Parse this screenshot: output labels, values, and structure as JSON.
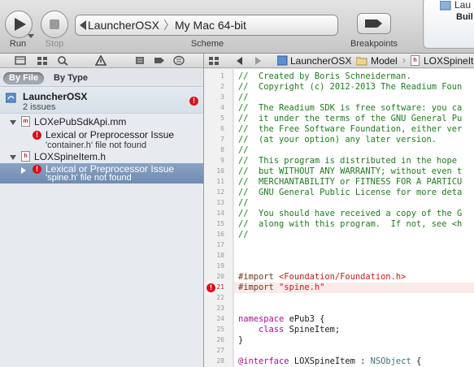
{
  "toolbar": {
    "run_label": "Run",
    "stop_label": "Stop",
    "scheme_target": "LauncherOSX",
    "scheme_destination": "My Mac 64-bit",
    "scheme_label": "Scheme",
    "breakpoints_label": "Breakpoints",
    "activity_title": "Lau",
    "activity_sub": "Buil"
  },
  "navigator": {
    "filter_by_file": "By File",
    "filter_by_type": "By Type",
    "project": {
      "name": "LauncherOSX",
      "count": "2 issues"
    },
    "files": [
      {
        "icon": "m",
        "name": "LOXePubSdkApi.mm",
        "issue_title": "Lexical or Preprocessor Issue",
        "issue_detail": "'container.h' file not found"
      },
      {
        "icon": "h",
        "name": "LOXSpineItem.h",
        "issue_title": "Lexical or Preprocessor Issue",
        "issue_detail": "'spine.h' file not found"
      }
    ]
  },
  "jumpbar": {
    "crumb1": "LauncherOSX",
    "crumb2": "Model",
    "crumb3": "LOXSpineIte"
  },
  "editor": {
    "lines": [
      {
        "n": "1",
        "t": "//  Created by Boris Schneiderman.",
        "c": "cmt"
      },
      {
        "n": "2",
        "t": "//  Copyright (c) 2012-2013 The Readium Foun",
        "c": "cmt"
      },
      {
        "n": "3",
        "t": "//",
        "c": "cmt"
      },
      {
        "n": "4",
        "t": "//  The Readium SDK is free software: you ca",
        "c": "cmt"
      },
      {
        "n": "5",
        "t": "//  it under the terms of the GNU General Pu",
        "c": "cmt"
      },
      {
        "n": "6",
        "t": "//  the Free Software Foundation, either ver",
        "c": "cmt"
      },
      {
        "n": "7",
        "t": "//  (at your option) any later version.",
        "c": "cmt"
      },
      {
        "n": "8",
        "t": "//",
        "c": "cmt"
      },
      {
        "n": "9",
        "t": "//  This program is distributed in the hope",
        "c": "cmt"
      },
      {
        "n": "10",
        "t": "//  but WITHOUT ANY WARRANTY; without even t",
        "c": "cmt"
      },
      {
        "n": "11",
        "t": "//  MERCHANTABILITY or FITNESS FOR A PARTICU",
        "c": "cmt"
      },
      {
        "n": "12",
        "t": "//  GNU General Public License for more deta",
        "c": "cmt"
      },
      {
        "n": "13",
        "t": "//",
        "c": "cmt"
      },
      {
        "n": "14",
        "t": "//  You should have received a copy of the G",
        "c": "cmt"
      },
      {
        "n": "15",
        "t": "//  along with this program.  If not, see <h",
        "c": "cmt"
      },
      {
        "n": "16",
        "t": "//",
        "c": "cmt"
      },
      {
        "n": "17",
        "t": "",
        "c": "plain"
      },
      {
        "n": "18",
        "t": "",
        "c": "plain"
      },
      {
        "n": "19",
        "t": "",
        "c": "plain"
      },
      {
        "n": "20",
        "t": "#import <Foundation/Foundation.h>",
        "c": "pp"
      },
      {
        "n": "21",
        "t": "#import \"spine.h\"",
        "c": "pp"
      },
      {
        "n": "22",
        "t": "",
        "c": "plain"
      },
      {
        "n": "23",
        "t": "",
        "c": "plain"
      },
      {
        "n": "24",
        "t": "namespace ePub3 {",
        "c": "plain"
      },
      {
        "n": "25",
        "t": "    class SpineItem;",
        "c": "plain"
      },
      {
        "n": "26",
        "t": "}",
        "c": "plain"
      },
      {
        "n": "27",
        "t": "",
        "c": "plain"
      },
      {
        "n": "28",
        "t": "@interface LOXSpineItem : NSObject {",
        "c": "plain"
      }
    ]
  },
  "colors": {
    "error": "#d6101b",
    "selection": "#7f97b9",
    "error_line": "#fbeaea"
  }
}
